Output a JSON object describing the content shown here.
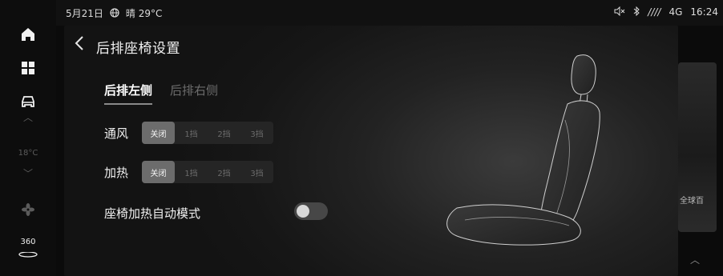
{
  "status_bar": {
    "date": "5月21日",
    "weather_icon": "globe-icon",
    "weather": "晴 29°C",
    "mute_icon": "speaker-mute-icon",
    "bluetooth_icon": "bluetooth-icon",
    "signal": "////",
    "network": "4G",
    "time": "16:24"
  },
  "sidebar": {
    "items": [
      {
        "icon": "home-icon"
      },
      {
        "icon": "apps-grid-icon"
      },
      {
        "icon": "car-icon"
      },
      {
        "icon": "temp-up-icon"
      },
      {
        "icon": "temp-down-icon"
      },
      {
        "icon": "fan-icon"
      }
    ],
    "temperature": "18°C",
    "camera_label": "360"
  },
  "header": {
    "back_icon": "chevron-left-icon",
    "title": "后排座椅设置"
  },
  "tabs": [
    {
      "label": "后排左侧",
      "active": true
    },
    {
      "label": "后排右侧",
      "active": false
    }
  ],
  "ventilation": {
    "label": "通风",
    "options": [
      "关闭",
      "1挡",
      "2挡",
      "3挡"
    ],
    "selected": "关闭"
  },
  "heating": {
    "label": "加热",
    "options": [
      "关闭",
      "1挡",
      "2挡",
      "3挡"
    ],
    "selected": "关闭"
  },
  "auto_heat_mode": {
    "label": "座椅加热自动模式",
    "enabled": false
  },
  "background_app": {
    "label": "全球百",
    "arrow_icon": "chevron-up-icon"
  },
  "colors": {
    "panel_bg": "#1c1c1c",
    "segment_active": "#6c6c6c",
    "text_primary": "#f0f0f0",
    "text_dim": "#6d6d6d"
  }
}
